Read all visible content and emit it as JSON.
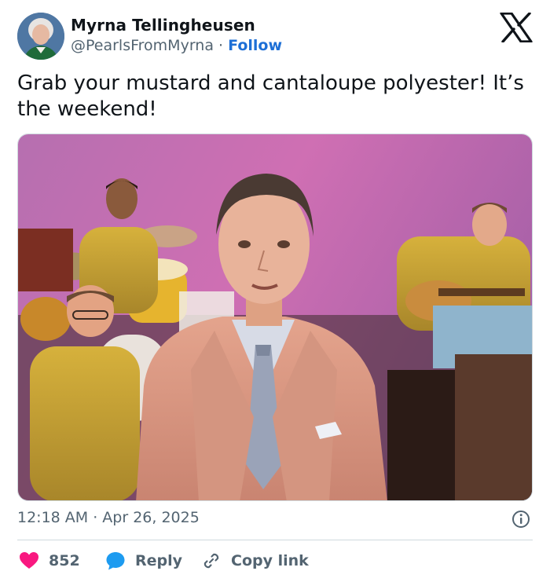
{
  "author": {
    "display_name": "Myrna Tellingheusen",
    "handle": "@PearlsFromMyrna",
    "separator": "·",
    "follow_label": "Follow"
  },
  "brand": {
    "logo_icon": "x-logo-icon"
  },
  "tweet": {
    "text": "Grab your mustard and cantaloupe polyester! It’s the weekend!",
    "timestamp": "12:18 AM · Apr 26, 2025"
  },
  "actions": {
    "likes_count": "852",
    "reply_label": "Reply",
    "copy_link_label": "Copy link"
  },
  "colors": {
    "like": "#f91880",
    "reply": "#1d9bf0",
    "follow": "#1d6fd6",
    "muted": "#536471",
    "text": "#0f1419"
  },
  "icons": [
    "x-logo-icon",
    "info-icon",
    "heart-icon",
    "reply-bubble-icon",
    "link-icon"
  ]
}
